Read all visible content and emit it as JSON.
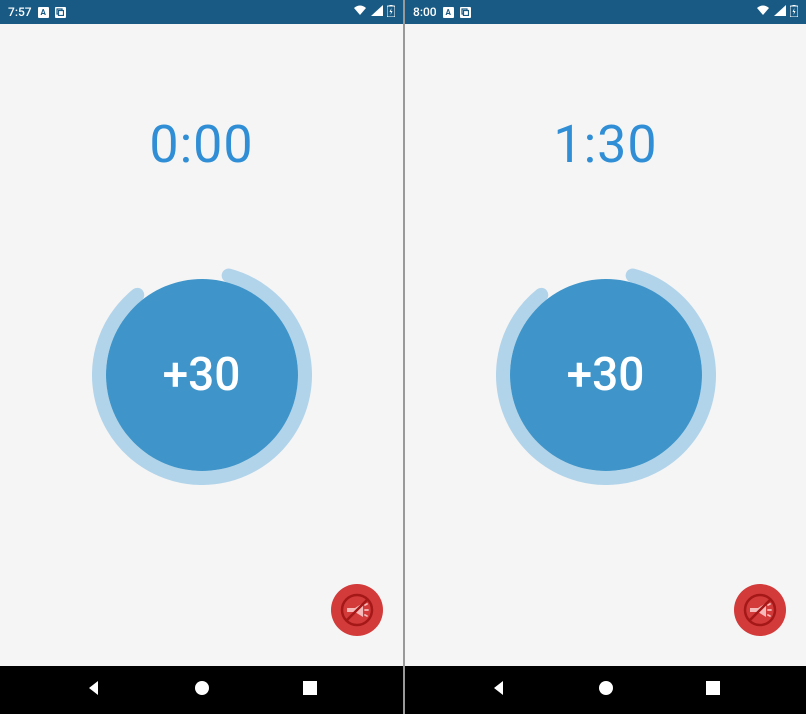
{
  "screens": [
    {
      "status": {
        "time": "7:57",
        "iconA": "A",
        "iconB": "❐"
      },
      "timer": "0:00",
      "dial_label": "+30"
    },
    {
      "status": {
        "time": "8:00",
        "iconA": "A",
        "iconB": "❐"
      },
      "timer": "1:30",
      "dial_label": "+30"
    }
  ],
  "colors": {
    "status_bar": "#185a84",
    "accent": "#2f8ed5",
    "dial_fill": "#3f95c9",
    "dial_ring": "#b2d4ea",
    "mute_button": "#d33a3a",
    "background": "#f5f5f5"
  }
}
